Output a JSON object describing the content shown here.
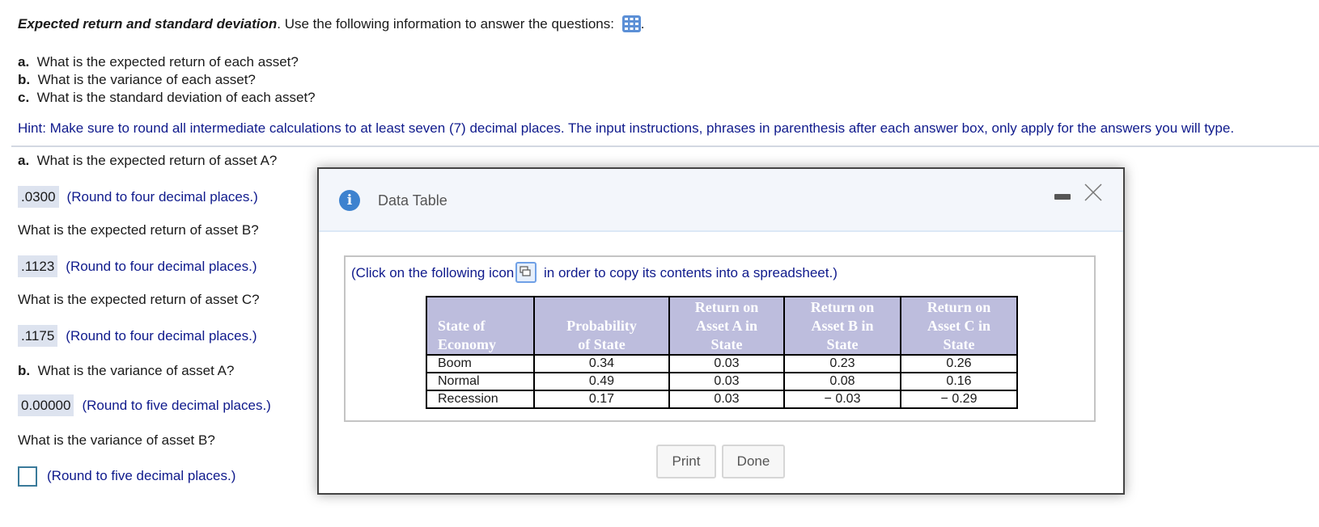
{
  "intro": {
    "title": "Expected return and standard deviation",
    "text": ".  Use the following information to answer the questions:",
    "trailing": ".",
    "icon": "table-grid-icon"
  },
  "questions": [
    {
      "letter": "a.",
      "text": "What is the expected return of each asset?"
    },
    {
      "letter": "b.",
      "text": "What is the variance of each asset?"
    },
    {
      "letter": "c.",
      "text": "What is the standard deviation of each asset?"
    }
  ],
  "hint": "Hint: Make sure to round all intermediate calculations to at least seven (7) decimal places. The input instructions, phrases in parenthesis after each answer box, only apply for the answers you will type.",
  "answers": {
    "a_label": "a.",
    "a_question": "What is the expected return of asset A?",
    "a_value": ".0300",
    "a_note": "(Round to four decimal places.)",
    "b_question": "What is the expected return of asset B?",
    "b_value": ".1123",
    "b_note": "(Round to four decimal places.)",
    "c_question": "What is the expected return of asset C?",
    "c_value": ".1175",
    "c_note": "(Round to four decimal places.)",
    "var_label": "b.",
    "var_a_question": "What is the variance of asset A?",
    "var_a_value": "0.00000",
    "var_a_note": "(Round to five decimal places.)",
    "var_b_question": "What is the variance of asset B?",
    "var_b_value": "",
    "var_b_note": "(Round to five decimal places.)"
  },
  "dialog": {
    "title": "Data Table",
    "copy_note_before": "(Click on the following icon",
    "copy_note_after": " in order to copy its contents into a spreadsheet.)",
    "print_label": "Print",
    "done_label": "Done",
    "table": {
      "headers": [
        [
          "State of",
          "Economy"
        ],
        [
          "Probability",
          "of State"
        ],
        [
          "Return on",
          "Asset A in",
          "State"
        ],
        [
          "Return on",
          "Asset B in",
          "State"
        ],
        [
          "Return on",
          "Asset C in",
          "State"
        ]
      ],
      "rows": [
        [
          "Boom",
          "0.34",
          "0.03",
          "0.23",
          "0.26"
        ],
        [
          "Normal",
          "0.49",
          "0.03",
          "0.08",
          "0.16"
        ],
        [
          "Recession",
          "0.17",
          "0.03",
          "− 0.03",
          "− 0.29"
        ]
      ]
    }
  },
  "colors": {
    "hint_text": "#0f1a8c",
    "table_header_bg": "#bdbddd",
    "answer_bg": "#dde3ef",
    "info_icon": "#3d82cf"
  }
}
